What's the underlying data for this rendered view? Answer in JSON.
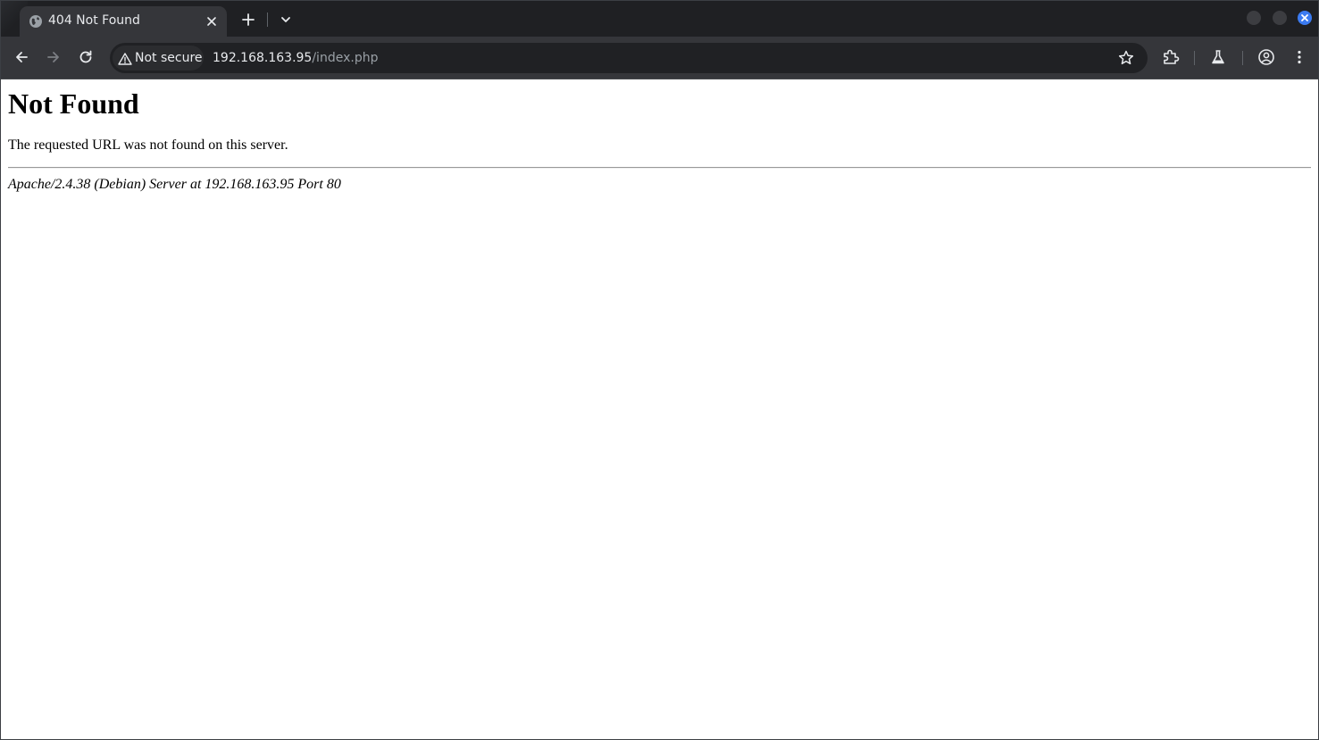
{
  "browser": {
    "tab": {
      "title": "404 Not Found",
      "favicon": "globe-icon"
    },
    "new_tab_icon": "plus-icon",
    "tab_search_icon": "chevron-down-icon",
    "window_controls": [
      "minimize-button",
      "maximize-button",
      "close-button"
    ],
    "accent_color": "#3b7bf1"
  },
  "toolbar": {
    "security_chip": "Not secure",
    "url_host": "192.168.163.95",
    "url_path": "/index.php",
    "icons": [
      "back-icon",
      "forward-icon",
      "reload-icon",
      "warning-icon",
      "star-icon",
      "extensions-icon",
      "labs-icon",
      "profile-icon",
      "menu-icon"
    ]
  },
  "page": {
    "heading": "Not Found",
    "message": "The requested URL was not found on this server.",
    "footer": "Apache/2.4.38 (Debian) Server at 192.168.163.95 Port 80"
  }
}
